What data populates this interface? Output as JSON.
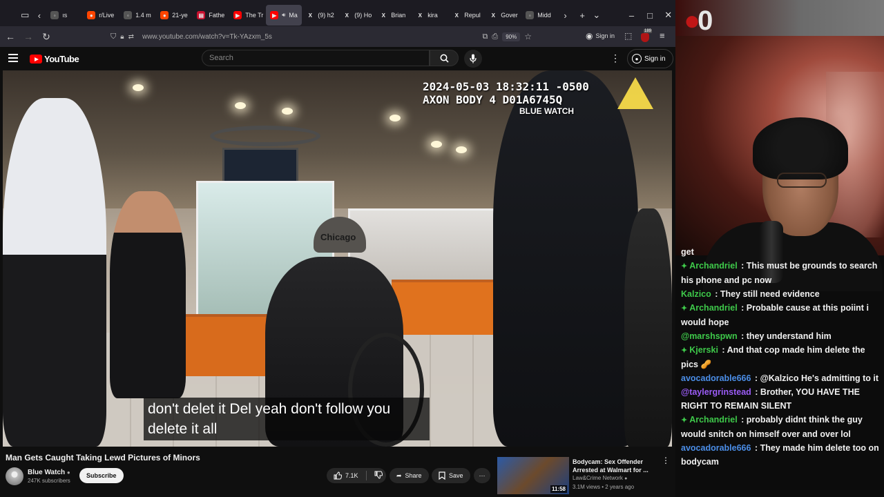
{
  "browser": {
    "tabs": [
      {
        "label": "ıs",
        "icon": "generic"
      },
      {
        "label": "r/Live",
        "icon": "reddit"
      },
      {
        "label": "1.4 m",
        "icon": "generic"
      },
      {
        "label": "21-ye",
        "icon": "reddit"
      },
      {
        "label": "Fathe",
        "icon": "news"
      },
      {
        "label": "The Tr",
        "icon": "youtube"
      },
      {
        "label": "Ma",
        "icon": "youtube",
        "active": true
      },
      {
        "label": "(9) h2",
        "icon": "x"
      },
      {
        "label": "(9) Ho",
        "icon": "x"
      },
      {
        "label": "Brian",
        "icon": "x"
      },
      {
        "label": "kira",
        "icon": "x"
      },
      {
        "label": "Repul",
        "icon": "x"
      },
      {
        "label": "Gover",
        "icon": "x"
      },
      {
        "label": "Midd",
        "icon": "generic"
      }
    ],
    "url": "www.youtube.com/watch?v=Tk-YAzxm_5s",
    "zoom": "90%",
    "sign_in": "Sign in",
    "badge_count": "189"
  },
  "youtube": {
    "logo_text": "YouTube",
    "search_placeholder": "Search",
    "sign_in": "Sign in",
    "video": {
      "timestamp_line1": "2024-05-03 18:32:11 -0500",
      "timestamp_line2": "AXON BODY 4 D01A6745Q",
      "watermark": "BLUE WATCH",
      "cap_text": "Chicago",
      "caption_line1": "don't delet it Del yeah don't follow you",
      "caption_line2": "delete it all"
    },
    "title": "Man Gets Caught Taking Lewd Pictures of Minors",
    "channel": {
      "name": "Blue Watch",
      "subscribers": "247K subscribers",
      "subscribe_label": "Subscribe"
    },
    "actions": {
      "likes": "7.1K",
      "share": "Share",
      "save": "Save"
    },
    "recommended": {
      "title": "Bodycam: Sex Offender Arrested at Walmart for ...",
      "channel": "Law&Crime Network",
      "meta": "3.1M views • 2 years ago",
      "duration": "11:58"
    }
  },
  "stream": {
    "logo_text": "0",
    "chat": [
      {
        "user": "",
        "text": "get",
        "color": "#f1f1f1",
        "badge": false
      },
      {
        "user": "Archandriel",
        "text": "This must be grounds to search his phone and pc now",
        "color": "#3ec94a",
        "badge": true
      },
      {
        "user": "Kalzico",
        "text": "They still need evidence",
        "color": "#3ec94a",
        "badge": false
      },
      {
        "user": "Archandriel",
        "text": "Probable cause at this poiint i would hope",
        "color": "#3ec94a",
        "badge": true
      },
      {
        "user": "@marshspwn",
        "text": "they understand him",
        "color": "#3ec94a",
        "badge": false
      },
      {
        "user": "Kjerski",
        "text": "And that cop made him delete the pics 🥜",
        "color": "#3ec94a",
        "badge": true
      },
      {
        "user": "avocadorable666",
        "text": "@Kalzico He's admitting to it",
        "color": "#4b8ee8",
        "badge": false
      },
      {
        "user": "@taylergrinstead",
        "text": "Brother, YOU HAVE THE RIGHT TO REMAIN SILENT",
        "color": "#9b5cf6",
        "badge": false
      },
      {
        "user": "Archandriel",
        "text": "probably didnt think the guy would snitch on himself over and over lol",
        "color": "#3ec94a",
        "badge": true
      },
      {
        "user": "avocadorable666",
        "text": "They made him delete too on bodycam",
        "color": "#4b8ee8",
        "badge": false
      }
    ]
  },
  "colors": {
    "yt_red": "#ff0000",
    "tab_bar": "#1c1b22",
    "url_bar": "#2b2a33",
    "chat_green": "#3ec94a",
    "chat_blue": "#4b8ee8",
    "chat_purple": "#9b5cf6"
  }
}
